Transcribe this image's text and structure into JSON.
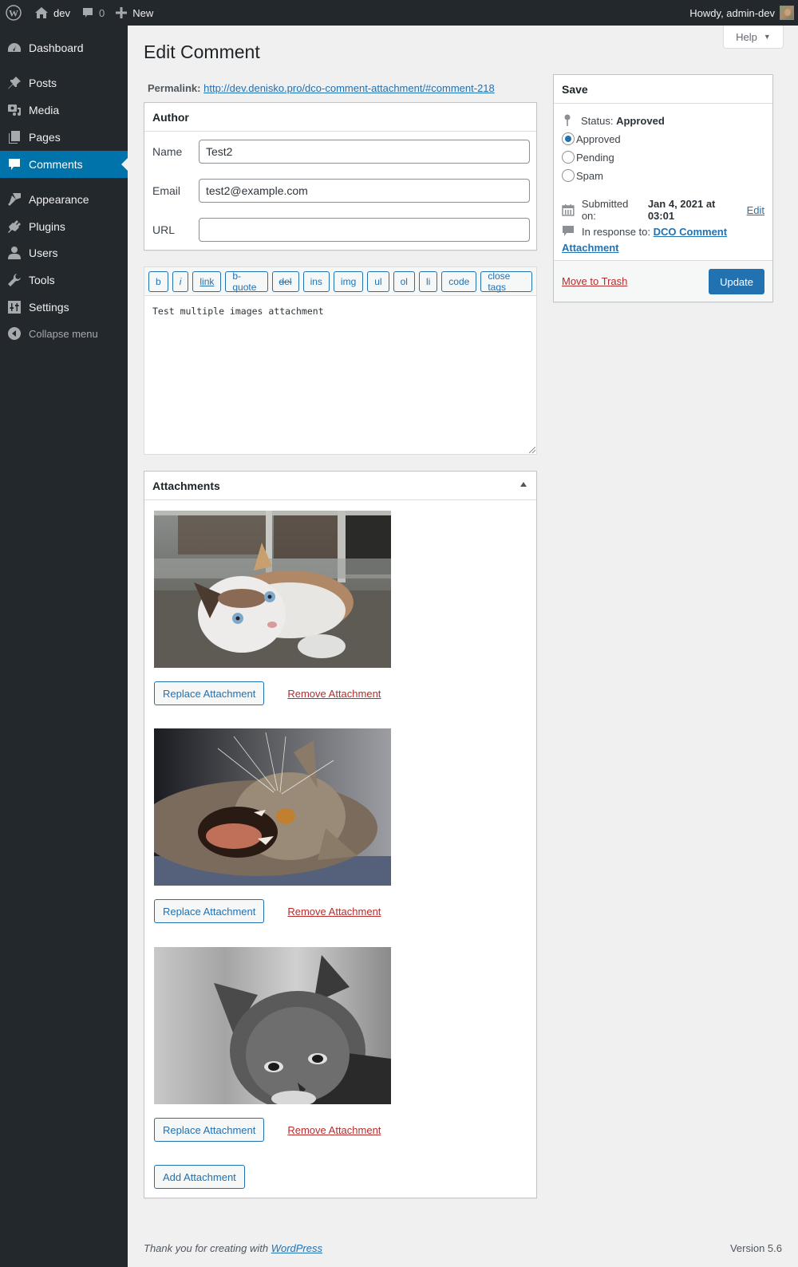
{
  "adminbar": {
    "site_name": "dev",
    "comments_count": "0",
    "new_label": "New",
    "greeting": "Howdy, admin-dev"
  },
  "sidebar": {
    "items": [
      {
        "label": "Dashboard",
        "icon": "dashboard-icon"
      },
      {
        "label": "Posts",
        "icon": "pin-icon"
      },
      {
        "label": "Media",
        "icon": "media-icon"
      },
      {
        "label": "Pages",
        "icon": "pages-icon"
      },
      {
        "label": "Comments",
        "icon": "comment-icon",
        "current": true
      },
      {
        "label": "Appearance",
        "icon": "brush-icon"
      },
      {
        "label": "Plugins",
        "icon": "plug-icon"
      },
      {
        "label": "Users",
        "icon": "user-icon"
      },
      {
        "label": "Tools",
        "icon": "wrench-icon"
      },
      {
        "label": "Settings",
        "icon": "sliders-icon"
      }
    ],
    "collapse_label": "Collapse menu"
  },
  "help_label": "Help",
  "page_title": "Edit Comment",
  "permalink": {
    "label": "Permalink:",
    "url": "http://dev.denisko.pro/dco-comment-attachment/#comment-218"
  },
  "author": {
    "title": "Author",
    "fields": [
      {
        "label": "Name",
        "value": "Test2"
      },
      {
        "label": "Email",
        "value": "test2@example.com"
      },
      {
        "label": "URL",
        "value": ""
      }
    ]
  },
  "editor": {
    "buttons": [
      "b",
      "i",
      "link",
      "b-quote",
      "del",
      "ins",
      "img",
      "ul",
      "ol",
      "li",
      "code",
      "close tags"
    ],
    "content": "Test multiple images attachment"
  },
  "attachments": {
    "title": "Attachments",
    "items": [
      {
        "description": "Calico cat lying on pavement",
        "replace_label": "Replace Attachment",
        "remove_label": "Remove Attachment"
      },
      {
        "description": "Tabby cat yawning",
        "replace_label": "Replace Attachment",
        "remove_label": "Remove Attachment"
      },
      {
        "description": "Black and white tabby kitten",
        "replace_label": "Replace Attachment",
        "remove_label": "Remove Attachment"
      }
    ],
    "add_label": "Add Attachment"
  },
  "save": {
    "title": "Save",
    "status_label": "Status:",
    "status_value": "Approved",
    "options": [
      {
        "label": "Approved",
        "checked": true
      },
      {
        "label": "Pending",
        "checked": false
      },
      {
        "label": "Spam",
        "checked": false
      }
    ],
    "submitted_label": "Submitted on:",
    "submitted_value": "Jan 4, 2021 at 03:01",
    "edit_label": "Edit",
    "response_label": "In response to:",
    "response_link": "DCO Comment Attachment",
    "trash_label": "Move to Trash",
    "update_label": "Update"
  },
  "footer": {
    "thanks_text": "Thank you for creating with",
    "wordpress_link": "WordPress",
    "version": "Version 5.6"
  },
  "colors": {
    "accent": "#2271b1",
    "menu_current": "#0073aa",
    "sidebar_bg": "#23282d",
    "danger": "#b32d2e"
  }
}
